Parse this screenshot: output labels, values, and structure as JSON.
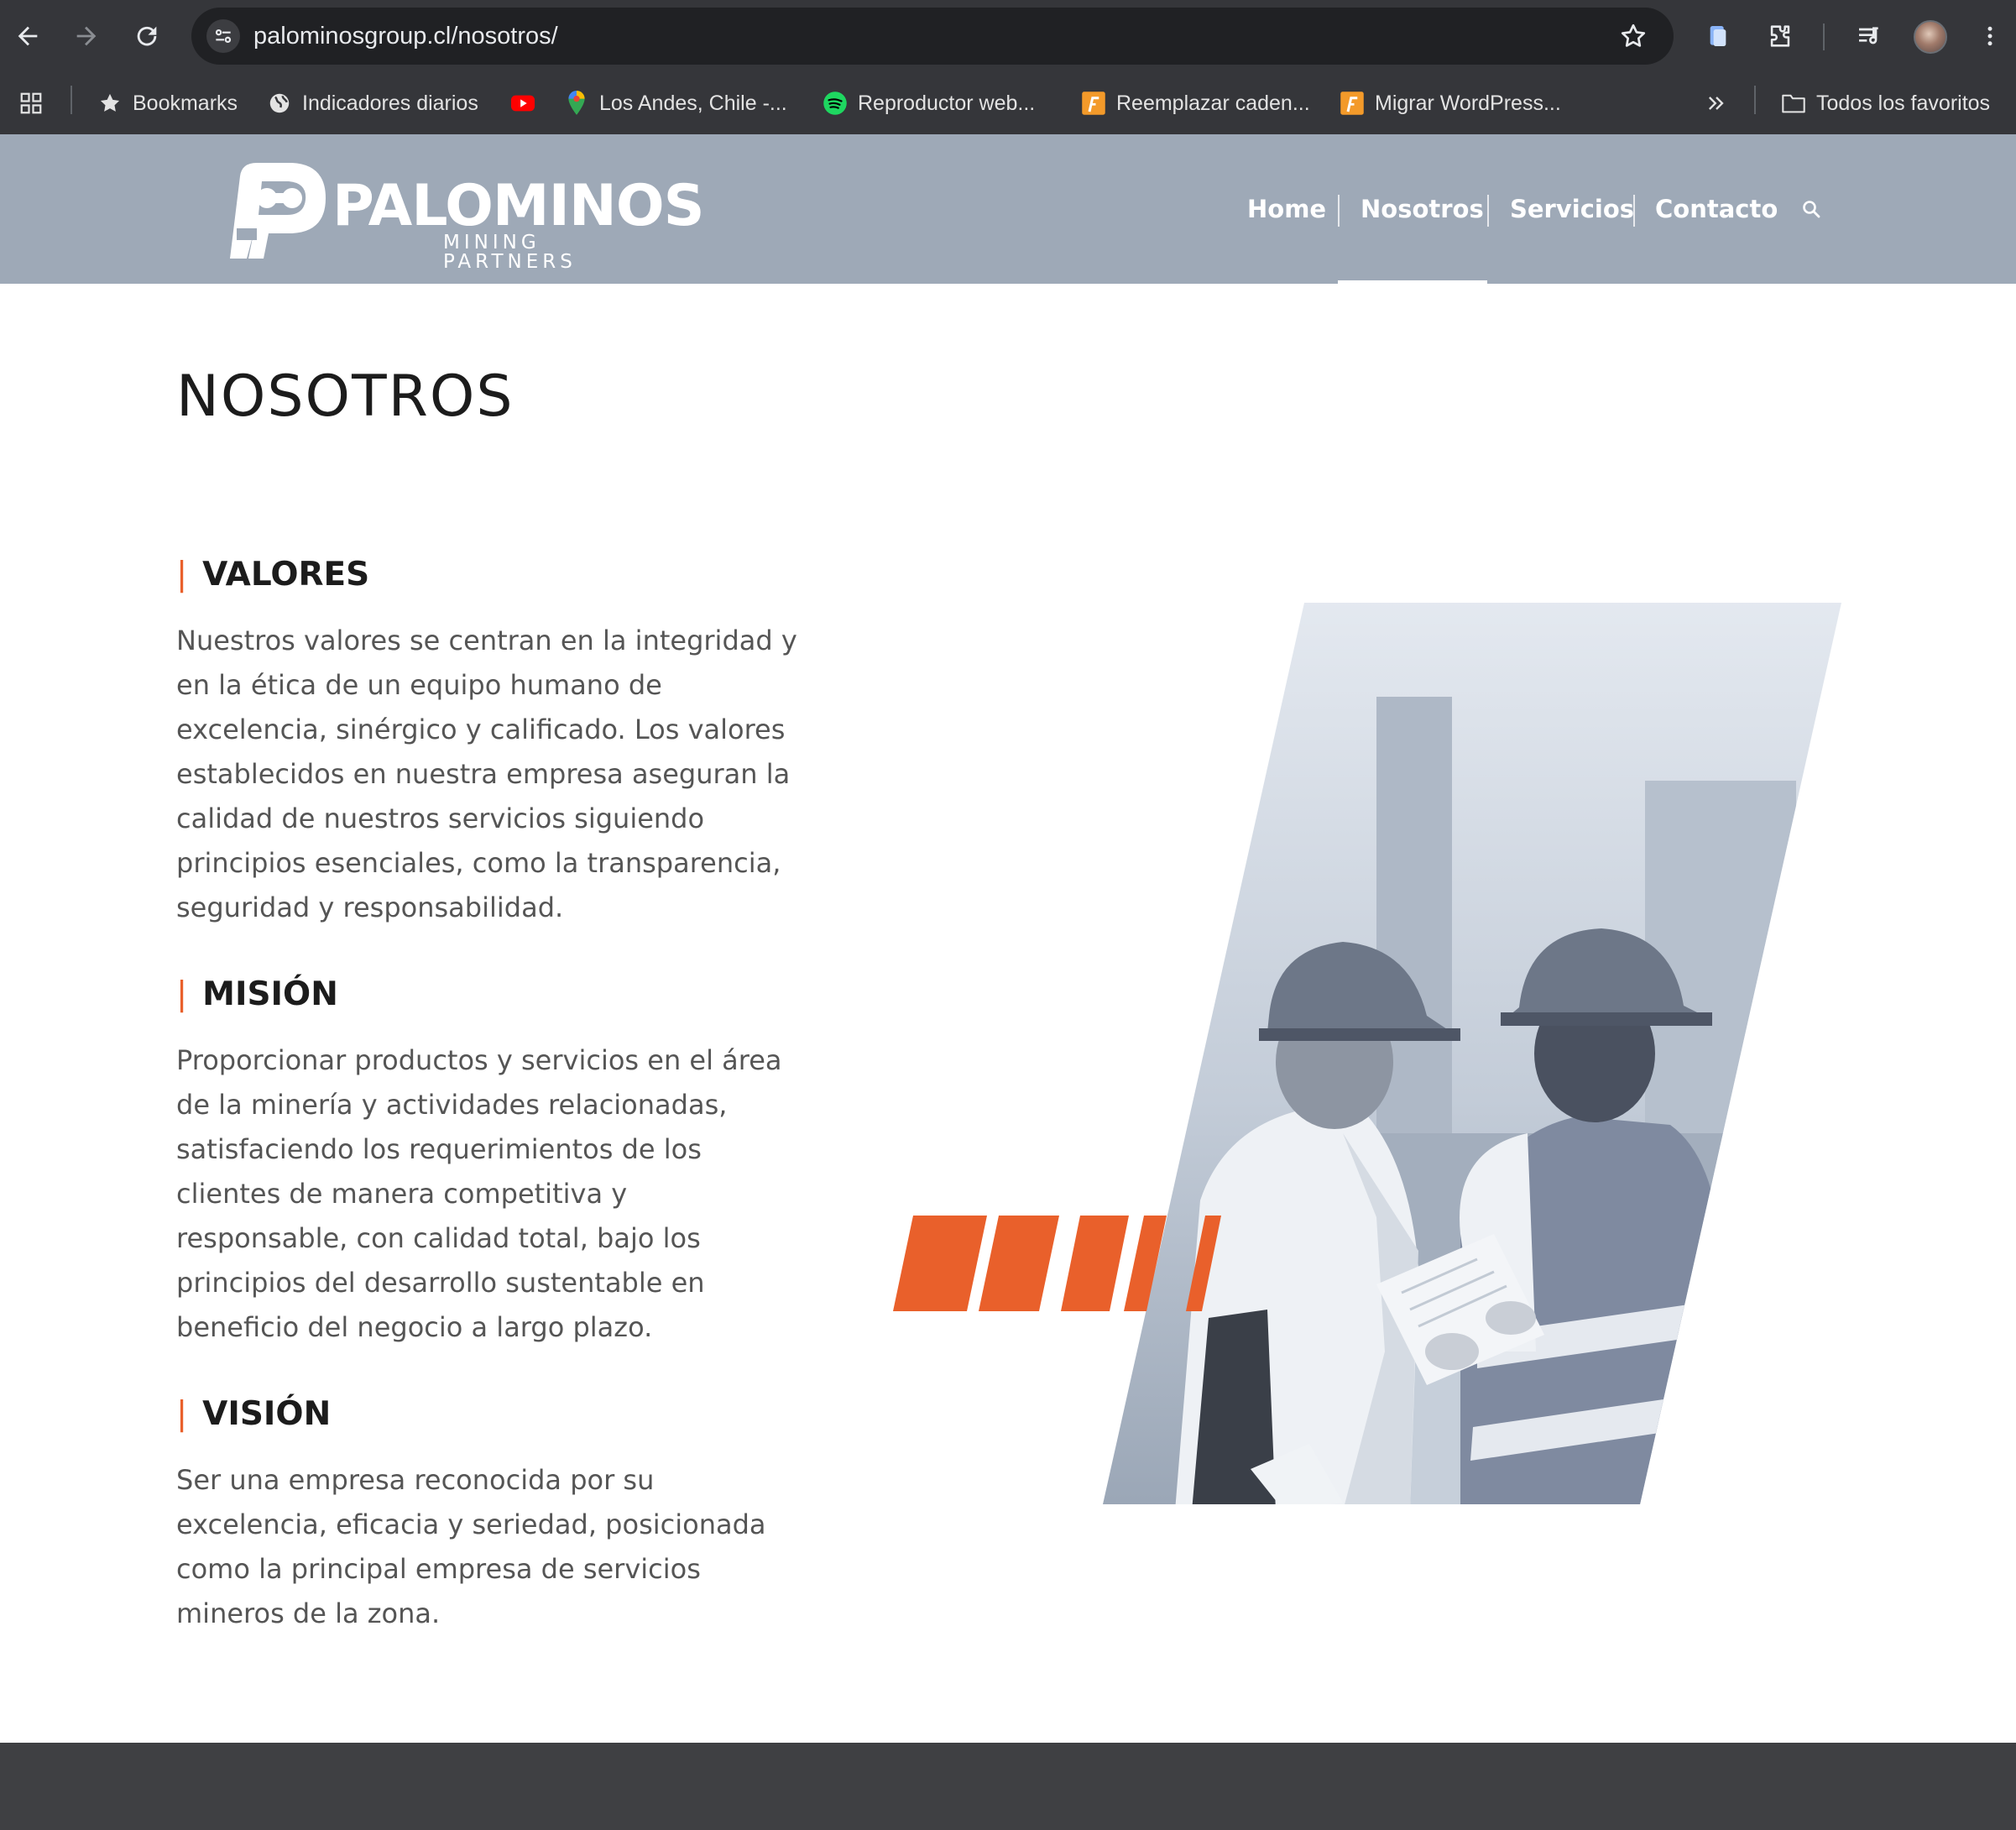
{
  "browser": {
    "url": "palominosgroup.cl/nosotros/",
    "bookmarks": [
      {
        "label": "Bookmarks",
        "icon": "star-icon"
      },
      {
        "label": "Indicadores diarios",
        "icon": "globe-icon"
      },
      {
        "label": "",
        "icon": "youtube-icon"
      },
      {
        "label": "Los Andes, Chile -...",
        "icon": "maps-pin-icon"
      },
      {
        "label": "Reproductor web...",
        "icon": "spotify-icon"
      },
      {
        "label": "Reemplazar caden...",
        "icon": "plugin-icon"
      },
      {
        "label": "Migrar WordPress...",
        "icon": "plugin-icon"
      }
    ],
    "all_bookmarks": "Todos los favoritos"
  },
  "site": {
    "logo_text": "PALOMINOS",
    "logo_subtext": "MINING PARTNERS",
    "nav": [
      "Home",
      "Nosotros",
      "Servicios",
      "Contacto"
    ],
    "active_nav": "Nosotros"
  },
  "page": {
    "title": "NOSOTROS",
    "sections": [
      {
        "heading": "VALORES",
        "body": "Nuestros valores se centran en la integridad y en la ética de un equipo humano de excelencia, sinérgico y calificado. Los valores establecidos en nuestra empresa aseguran la calidad de nuestros servicios siguiendo principios esenciales, como la transparencia, seguridad y responsabilidad."
      },
      {
        "heading": "MISIÓN",
        "body": "Proporcionar productos y servicios en el área de la minería y actividades relacionadas, satisfaciendo los requerimientos de los clientes de manera competitiva y responsable, con calidad total, bajo los principios del desarrollo sustentable en beneficio del negocio a largo plazo."
      },
      {
        "heading": "VISIÓN",
        "body": "Ser una empresa reconocida por su excelencia, eficacia y seriedad, posicionada como la principal empresa de servicios mineros de la zona."
      }
    ]
  },
  "colors": {
    "accent": "#e9602b",
    "header_bg": "#9ea9b7",
    "chrome_bg": "#35363a",
    "footer_bg": "#3f4043"
  }
}
